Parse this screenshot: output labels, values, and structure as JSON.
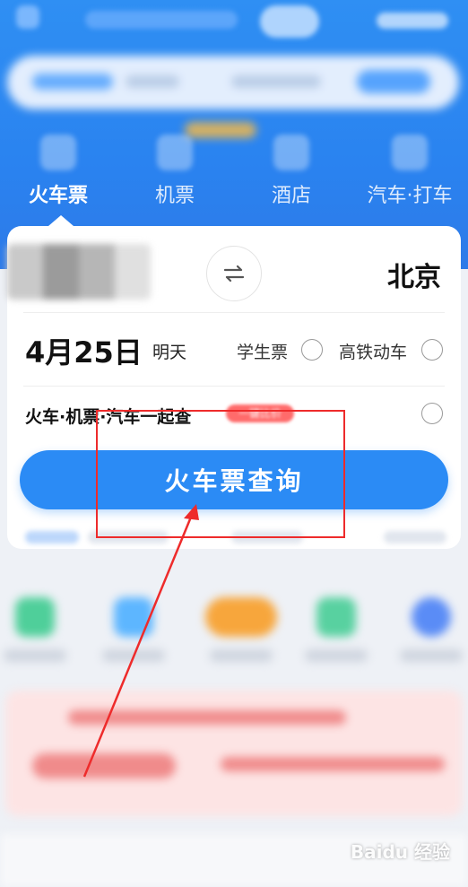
{
  "tabs": [
    {
      "label": "火车票",
      "active": true
    },
    {
      "label": "机票",
      "active": false
    },
    {
      "label": "酒店",
      "active": false
    },
    {
      "label": "汽车·打车",
      "active": false
    }
  ],
  "booking": {
    "to_city": "北京",
    "date": "4月25日",
    "day": "明天",
    "options": [
      {
        "label": "学生票",
        "checked": false
      },
      {
        "label": "高铁动车",
        "checked": false
      }
    ],
    "combo_label": "火车·机票·汽车一起查",
    "combo_badge": "一键比价",
    "search_button": "火车票查询"
  },
  "watermark": "Baidu 经验",
  "colors": {
    "brand_blue": "#2b8bf5",
    "annotation_red": "#ee2b2b"
  },
  "icons": {
    "swap": "swap-arrows-icon"
  }
}
